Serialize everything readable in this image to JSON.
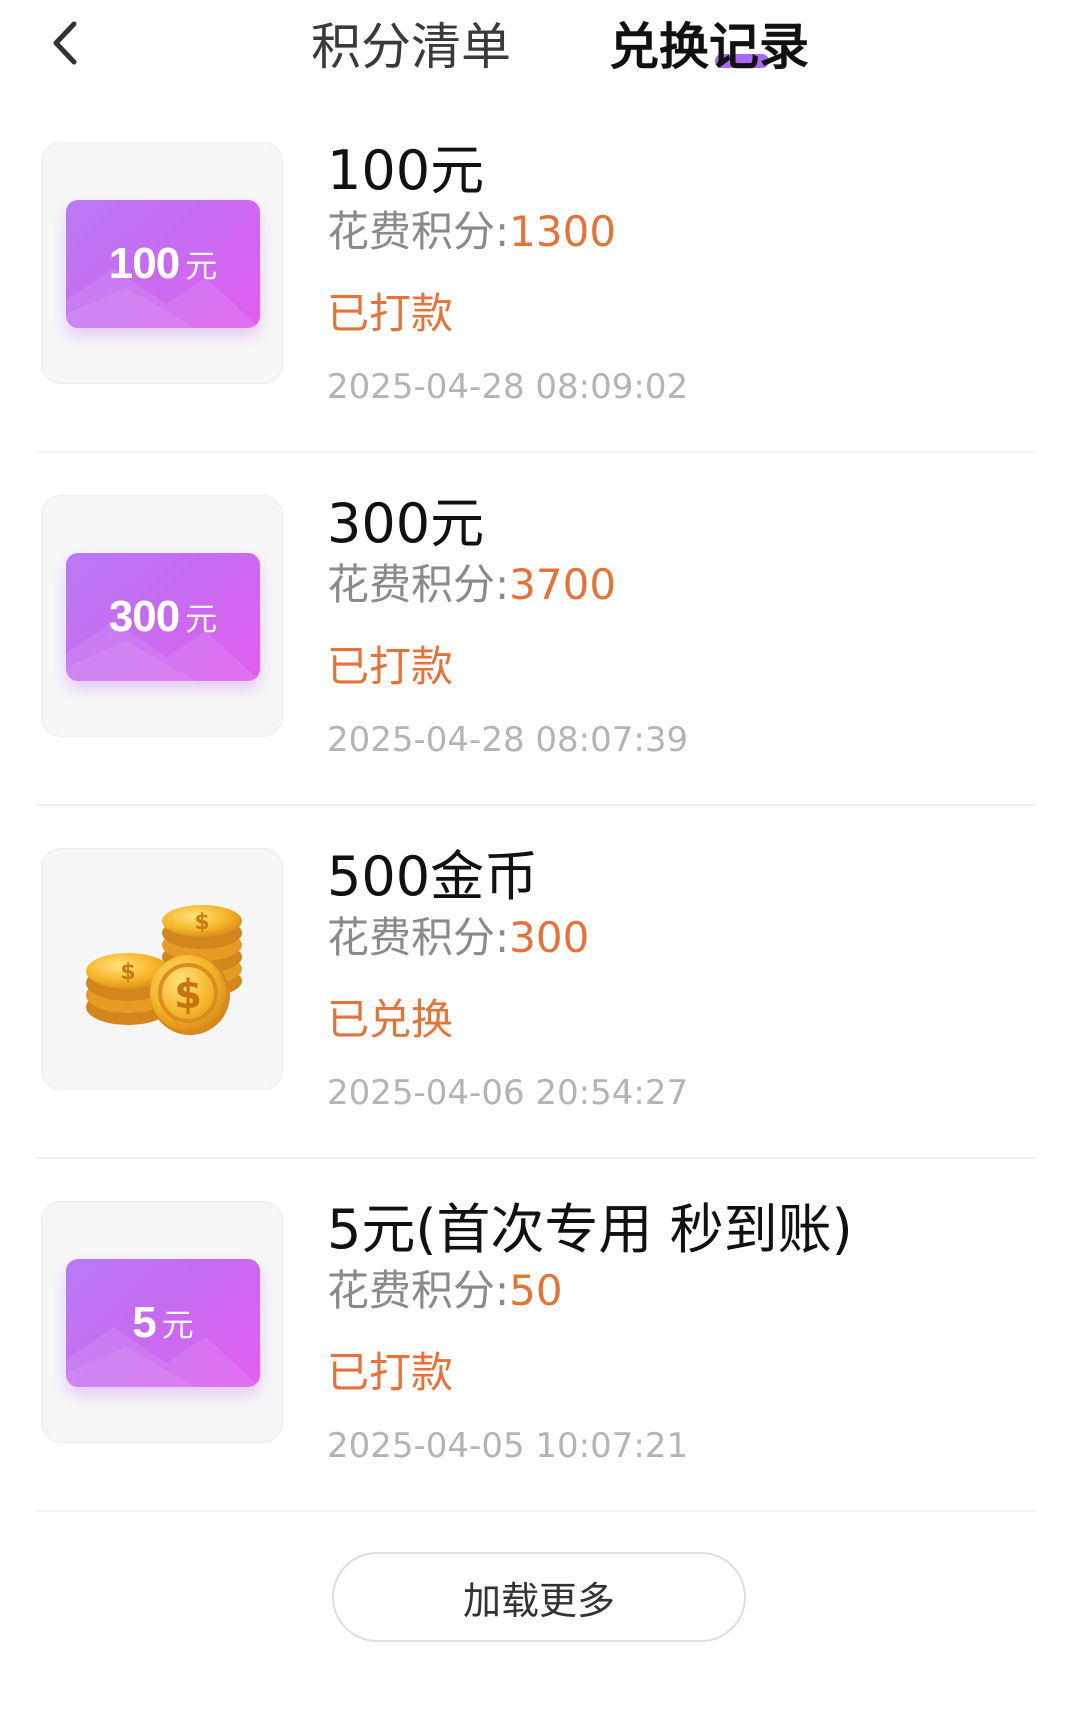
{
  "header": {
    "back_icon": "chevron-left-icon",
    "tabs": [
      {
        "label": "积分清单",
        "active": false
      },
      {
        "label": "兑换记录",
        "active": true
      }
    ],
    "active_color": "#9a4ef3"
  },
  "records": [
    {
      "title": "100元",
      "thumb": {
        "type": "cash-card",
        "amount": "100",
        "unit": "元"
      },
      "cost_label": "花费积分:",
      "cost_value": "1300",
      "status": "已打款",
      "time": "2025-04-28 08:09:02"
    },
    {
      "title": "300元",
      "thumb": {
        "type": "cash-card",
        "amount": "300",
        "unit": "元"
      },
      "cost_label": "花费积分:",
      "cost_value": "3700",
      "status": "已打款",
      "time": "2025-04-28 08:07:39"
    },
    {
      "title": "500金币",
      "thumb": {
        "type": "coins-icon"
      },
      "cost_label": "花费积分:",
      "cost_value": "300",
      "status": "已兑换",
      "time": "2025-04-06 20:54:27"
    },
    {
      "title": "5元(首次专用 秒到账)",
      "thumb": {
        "type": "cash-card",
        "amount": "5",
        "unit": "元"
      },
      "cost_label": "花费积分:",
      "cost_value": "50",
      "status": "已打款",
      "time": "2025-04-05 10:07:21"
    }
  ],
  "load_more_label": "加载更多",
  "colors": {
    "accent_orange": "#e4733a",
    "card_gradient_start": "#b97af4",
    "card_gradient_end": "#e25ef0",
    "muted_text": "#8a8a8a",
    "timestamp_text": "#b4b4b4"
  }
}
